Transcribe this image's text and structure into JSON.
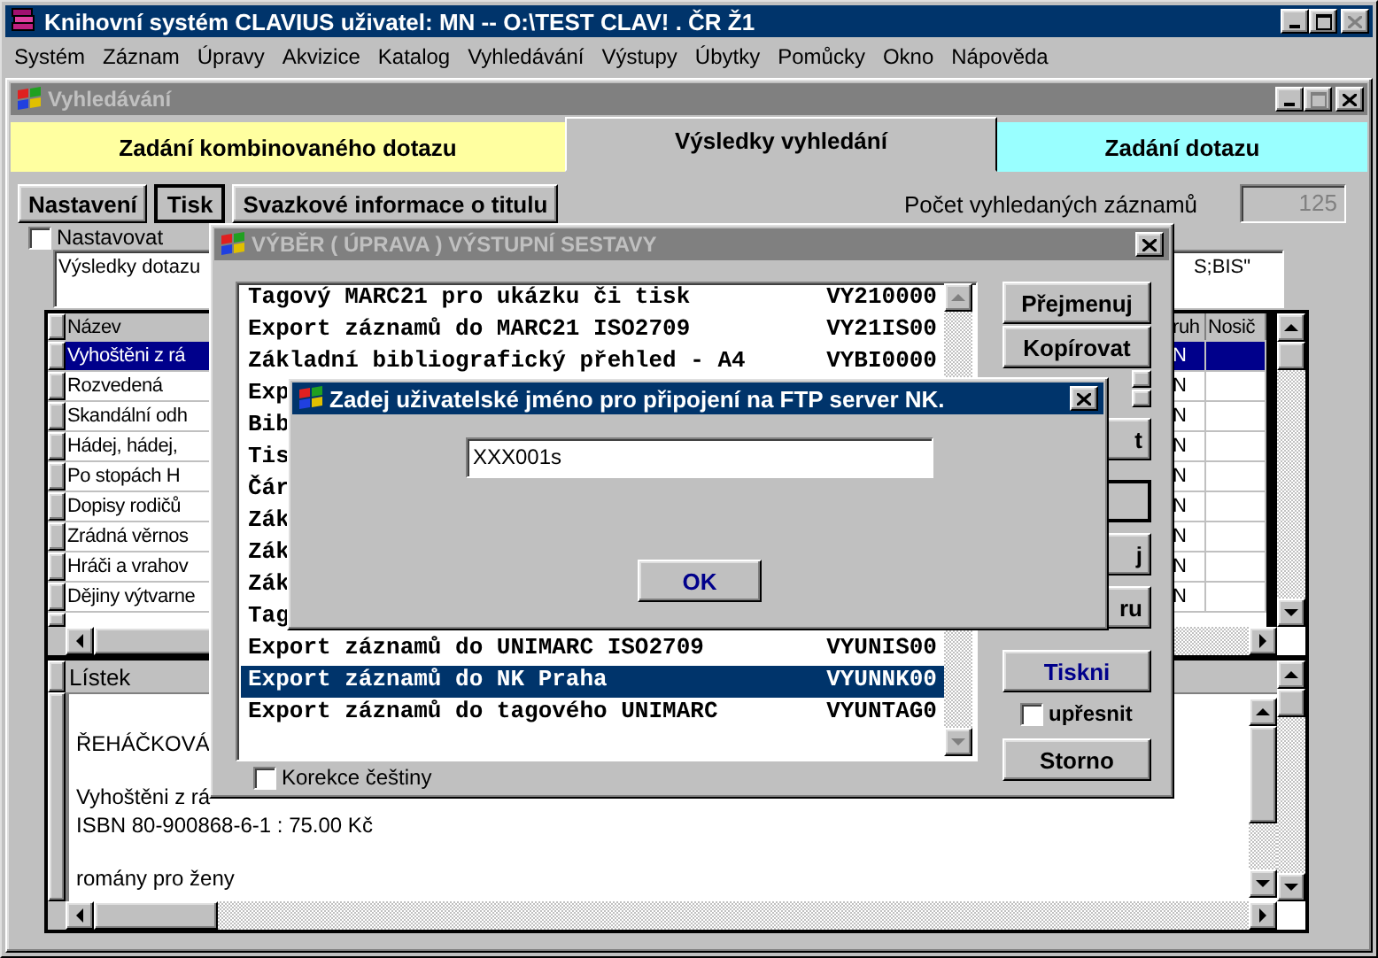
{
  "app_window": {
    "title": "Knihovní systém CLAVIUS uživatel: MN -- O:\\TEST CLAV! . ČR Ž1"
  },
  "menu": [
    "Systém",
    "Záznam",
    "Úpravy",
    "Akvizice",
    "Katalog",
    "Vyhledávání",
    "Výstupy",
    "Úbytky",
    "Pomůcky",
    "Okno",
    "Nápověda"
  ],
  "search_window": {
    "title": "Vyhledávání"
  },
  "tabs": [
    {
      "label": "Zadání kombinovaného dotazu",
      "selected": false,
      "color": "#ffffa0"
    },
    {
      "label": "Výsledky vyhledání",
      "selected": true,
      "color": "#c0c0c0"
    },
    {
      "label": "Zadání dotazu",
      "selected": false,
      "color": "#99ffff"
    }
  ],
  "toolbar": [
    {
      "label": "Nastavení",
      "focused": false
    },
    {
      "label": "Tisk",
      "focused": true
    },
    {
      "label": "Svazkové informace o titulu",
      "focused": false
    }
  ],
  "record_count": {
    "label": "Počet vyhledaných záznamů",
    "value": "125"
  },
  "adjust_checkbox": {
    "label": "Nastavovat",
    "checked": false
  },
  "query_box": {
    "text_start": "Výsledky dotazu",
    "text_end": "S;BIS\""
  },
  "results_table": {
    "columns": [
      "Název",
      "ruh",
      "Nosič"
    ],
    "rows": [
      {
        "title": "Vyhoštěni z rá",
        "column_2": "N",
        "selected": true
      },
      {
        "title": "Rozvedená",
        "column_2": "N",
        "selected": false
      },
      {
        "title": "Skandální odh",
        "column_2": "N",
        "selected": false
      },
      {
        "title": "Hádej, hádej,",
        "column_2": "N",
        "selected": false
      },
      {
        "title": "Po stopách H",
        "column_2": "N",
        "selected": false
      },
      {
        "title": "Dopisy rodičů",
        "column_2": "N",
        "selected": false
      },
      {
        "title": "Zrádná věrnos",
        "column_2": "N",
        "selected": false
      },
      {
        "title": "Hráči a vrahov",
        "column_2": "N",
        "selected": false
      },
      {
        "title": "Dějiny výtvarne",
        "column_2": "N",
        "selected": false
      }
    ]
  },
  "card_pane": {
    "heading": "Lístek",
    "paragraphs": [
      [
        "ŘEHÁČKOVÁ"
      ],
      [
        "Vyhoštěni z rá",
        "ISBN 80-900868-6-1 : 75.00 Kč"
      ],
      [
        "romány pro ženy"
      ]
    ]
  },
  "output_dialog": {
    "title": "VÝBĚR ( ÚPRAVA ) VÝSTUPNÍ SESTAVY",
    "items": [
      {
        "name": "Tagový MARC21 pro ukázku či tisk",
        "code": "VY210000",
        "selected": false
      },
      {
        "name": "Export záznamů do MARC21 ISO2709",
        "code": "VY21IS00",
        "selected": false
      },
      {
        "name": "Základní bibliografický přehled - A4",
        "code": "VYBI0000",
        "selected": false
      },
      {
        "name": "Exp",
        "selected": false
      },
      {
        "name": "Bib",
        "selected": false
      },
      {
        "name": "Tis",
        "selected": false
      },
      {
        "name": "Čár",
        "selected": false
      },
      {
        "name": "Zák",
        "selected": false
      },
      {
        "name": "Zák",
        "selected": false
      },
      {
        "name": "Zák",
        "selected": false
      },
      {
        "name": "Tag",
        "selected": false
      },
      {
        "name": "Export záznamů do UNIMARC ISO2709",
        "code": "VYUNIS00",
        "selected": false
      },
      {
        "name": "Export záznamů do NK Praha",
        "code": "VYUNNK00",
        "selected": true
      },
      {
        "name": "Export záznamů do tagového UNIMARC",
        "code": "VYUNTAG0",
        "selected": false
      }
    ],
    "side_buttons": [
      {
        "kind": "full",
        "label": "Přejmenuj",
        "focused": false
      },
      {
        "kind": "full",
        "label": "Kopírovat",
        "focused": false
      },
      {
        "kind": "partial",
        "label": "t",
        "focused": false
      },
      {
        "kind": "blank",
        "focused": true
      },
      {
        "kind": "partial",
        "label": "j",
        "focused": false
      },
      {
        "kind": "partial",
        "label": "ru",
        "focused": false
      }
    ],
    "print_button": "Tiskni",
    "refine_checkbox": {
      "label": "upřesnit",
      "checked": false
    },
    "cancel_button": "Storno",
    "czech_checkbox": {
      "label": "Korekce češtiny",
      "checked": false
    }
  },
  "ftp_dialog": {
    "title": "Zadej uživatelské jméno pro připojení na FTP server NK.",
    "username": "XXX001s",
    "ok_button": "OK"
  }
}
